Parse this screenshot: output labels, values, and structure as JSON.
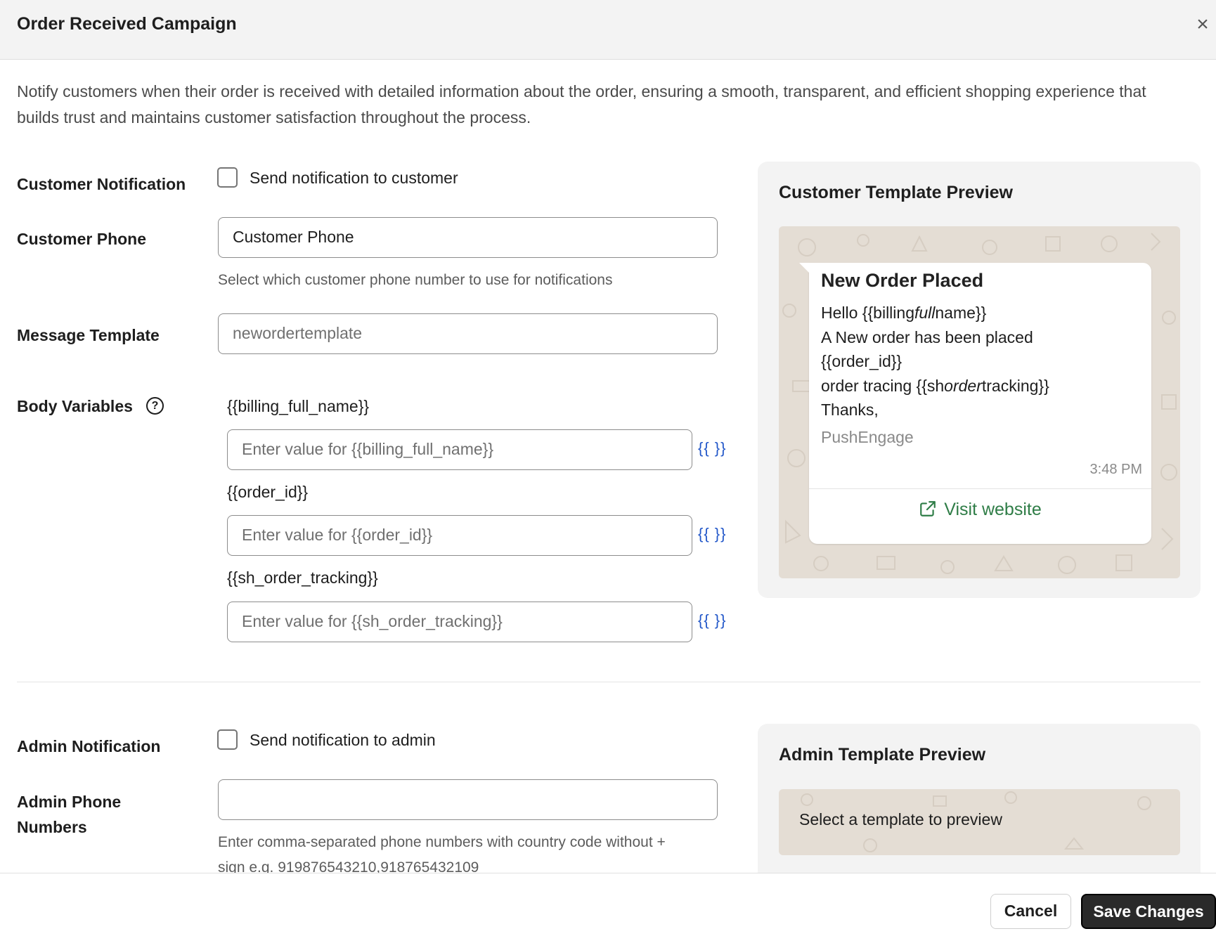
{
  "header": {
    "title": "Order Received Campaign",
    "close_label": "×"
  },
  "description": "Notify customers when their order is received with detailed information about the order, ensuring a smooth, transparent, and efficient shopping experience that builds trust and maintains customer satisfaction throughout the process.",
  "customer": {
    "notification_label": "Customer Notification",
    "notification_checkbox_label": "Send notification to customer",
    "notification_checked": false,
    "phone_label": "Customer Phone",
    "phone_value": "Customer Phone",
    "phone_help": "Select which customer phone number to use for notifications",
    "template_label": "Message Template",
    "template_value": "newordertemplate",
    "body_variables_label": "Body Variables",
    "variables": [
      {
        "name": "{{billing_full_name}}",
        "placeholder": "Enter value for {{billing_full_name}}",
        "button": "{{ }}"
      },
      {
        "name": "{{order_id}}",
        "placeholder": "Enter value for {{order_id}}",
        "button": "{{ }}"
      },
      {
        "name": "{{sh_order_tracking}}",
        "placeholder": "Enter value for {{sh_order_tracking}}",
        "button": "{{ }}"
      }
    ]
  },
  "customer_preview": {
    "title": "Customer Template Preview",
    "message_header": "New Order Placed",
    "body": {
      "line1_pre": "Hello {{billing",
      "line1_italic": "full",
      "line1_post": "name}}",
      "line2": "A New order has been placed",
      "line3": "{{order_id}}",
      "line4_pre": "order tracing {{sh",
      "line4_italic": "order",
      "line4_post": "tracking}}",
      "line5": "Thanks,"
    },
    "footer": "PushEngage",
    "time": "3:48 PM",
    "button": "Visit website"
  },
  "admin": {
    "notification_label": "Admin Notification",
    "notification_checkbox_label": "Send notification to admin",
    "notification_checked": false,
    "phone_label_line1": "Admin Phone",
    "phone_label_line2": "Numbers",
    "phone_value": "",
    "phone_help_line1": "Enter comma-separated phone numbers with country code without +",
    "phone_help_line2": "sign e.g. 919876543210,918765432109"
  },
  "admin_preview": {
    "title": "Admin Template Preview",
    "empty_text": "Select a template to preview"
  },
  "footer": {
    "cancel_label": "Cancel",
    "save_label": "Save Changes"
  },
  "colors": {
    "accent_link": "#2257c9",
    "visit_green": "#2f7d47",
    "wa_background": "#e4ddd4",
    "save_bg": "#2a2a2a"
  }
}
